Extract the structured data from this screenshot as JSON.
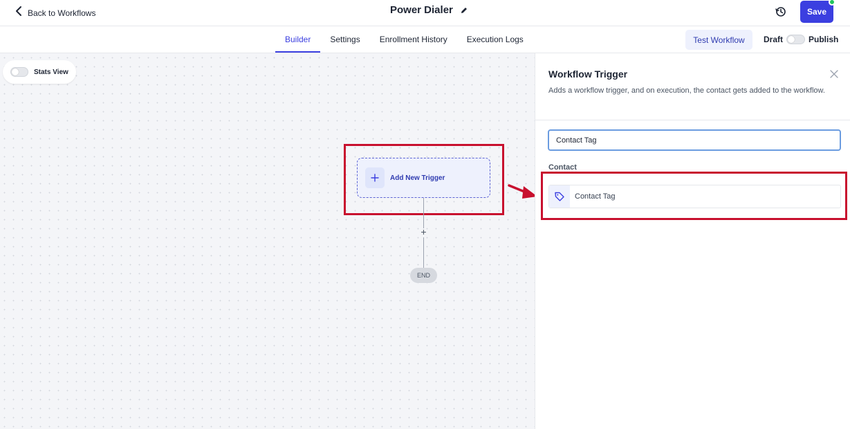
{
  "header": {
    "back_label": "Back to Workflows",
    "title": "Power Dialer",
    "save_label": "Save"
  },
  "tabs": [
    {
      "label": "Builder",
      "active": true
    },
    {
      "label": "Settings",
      "active": false
    },
    {
      "label": "Enrollment History",
      "active": false
    },
    {
      "label": "Execution Logs",
      "active": false
    }
  ],
  "actions": {
    "test_label": "Test Workflow",
    "draft_label": "Draft",
    "publish_label": "Publish",
    "publish_toggle_on": false
  },
  "canvas": {
    "stats_label": "Stats View",
    "stats_toggle_on": false,
    "trigger_label": "Add New Trigger",
    "add_step_glyph": "+",
    "end_label": "END"
  },
  "panel": {
    "title": "Workflow Trigger",
    "description": "Adds a workflow trigger, and on execution, the contact gets added to the workflow.",
    "search_value": "Contact Tag",
    "section_label": "Contact",
    "option_label": "Contact Tag",
    "option_icon": "tag-icon"
  },
  "colors": {
    "accent": "#3b3fe0",
    "highlight": "#c8102e",
    "status": "#22c55e"
  }
}
